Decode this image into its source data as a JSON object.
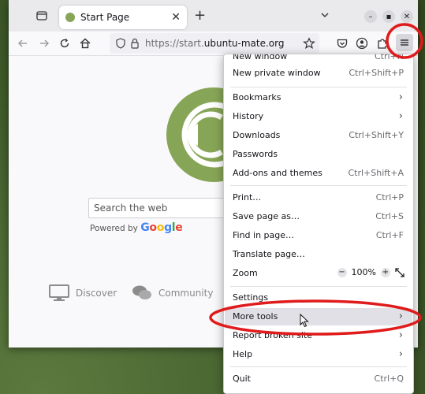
{
  "tab": {
    "title": "Start Page"
  },
  "urlbar": {
    "prefix": "https://start.",
    "domain": "ubuntu-mate.org"
  },
  "page": {
    "search_placeholder": "Search the web",
    "powered_by": "Powered by",
    "google": [
      "G",
      "o",
      "o",
      "g",
      "l",
      "e"
    ],
    "google_colors": [
      "#4285F4",
      "#EA4335",
      "#FBBC05",
      "#4285F4",
      "#34A853",
      "#EA4335"
    ],
    "links": [
      {
        "label": "Discover",
        "icon": "monitor-icon"
      },
      {
        "label": "Community",
        "icon": "chat-bubbles-icon"
      }
    ],
    "logo_color": "#87a556"
  },
  "menu": {
    "new_window": {
      "label": "New window",
      "shortcut": "Ctrl+N"
    },
    "new_private": {
      "label": "New private window",
      "shortcut": "Ctrl+Shift+P"
    },
    "bookmarks": {
      "label": "Bookmarks"
    },
    "history": {
      "label": "History"
    },
    "downloads": {
      "label": "Downloads",
      "shortcut": "Ctrl+Shift+Y"
    },
    "passwords": {
      "label": "Passwords"
    },
    "addons": {
      "label": "Add-ons and themes",
      "shortcut": "Ctrl+Shift+A"
    },
    "print": {
      "label": "Print…",
      "shortcut": "Ctrl+P"
    },
    "save_page": {
      "label": "Save page as…",
      "shortcut": "Ctrl+S"
    },
    "find": {
      "label": "Find in page…",
      "shortcut": "Ctrl+F"
    },
    "translate": {
      "label": "Translate page…"
    },
    "zoom": {
      "label": "Zoom",
      "minus": "−",
      "value": "100%",
      "plus": "+"
    },
    "settings": {
      "label": "Settings"
    },
    "more_tools": {
      "label": "More tools"
    },
    "report": {
      "label": "Report broken site"
    },
    "help": {
      "label": "Help"
    },
    "quit": {
      "label": "Quit",
      "shortcut": "Ctrl+Q"
    }
  },
  "annotation_color": "#e01b1b"
}
